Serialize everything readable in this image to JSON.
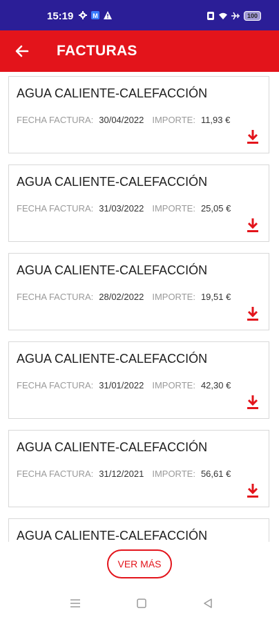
{
  "status_bar": {
    "time": "15:19",
    "battery": "100",
    "icons_left": [
      "settings-icon",
      "m-app-icon",
      "warning-icon"
    ],
    "icons_right": [
      "nfc-icon",
      "wifi-icon",
      "airplane-icon",
      "battery-icon"
    ]
  },
  "appbar": {
    "title": "FACTURAS",
    "back_icon": "arrow-left-icon",
    "color": "#e3141b"
  },
  "invoices": [
    {
      "title": "AGUA CALIENTE-CALEFACCIÓN",
      "fecha_label": "FECHA FACTURA:",
      "fecha": "30/04/2022",
      "importe_label": "IMPORTE:",
      "importe": "11,93 €"
    },
    {
      "title": "AGUA CALIENTE-CALEFACCIÓN",
      "fecha_label": "FECHA FACTURA:",
      "fecha": "31/03/2022",
      "importe_label": "IMPORTE:",
      "importe": "25,05 €"
    },
    {
      "title": "AGUA CALIENTE-CALEFACCIÓN",
      "fecha_label": "FECHA FACTURA:",
      "fecha": "28/02/2022",
      "importe_label": "IMPORTE:",
      "importe": "19,51 €"
    },
    {
      "title": "AGUA CALIENTE-CALEFACCIÓN",
      "fecha_label": "FECHA FACTURA:",
      "fecha": "31/01/2022",
      "importe_label": "IMPORTE:",
      "importe": "42,30 €"
    },
    {
      "title": "AGUA CALIENTE-CALEFACCIÓN",
      "fecha_label": "FECHA FACTURA:",
      "fecha": "31/12/2021",
      "importe_label": "IMPORTE:",
      "importe": "56,61 €"
    },
    {
      "title": "AGUA CALIENTE-CALEFACCIÓN"
    }
  ],
  "ver_mas_label": "VER MÁS",
  "navbar": [
    "menu-icon",
    "home-square-icon",
    "back-triangle-icon"
  ]
}
